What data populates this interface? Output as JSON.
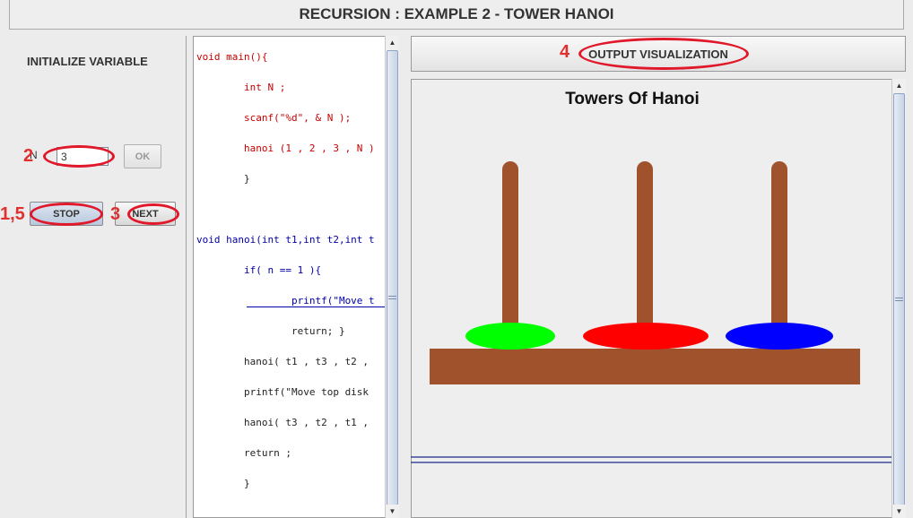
{
  "title": "RECURSION : EXAMPLE 2 - TOWER HANOI",
  "left": {
    "init_label": "INITIALIZE VARIABLE",
    "n_label": "N",
    "n_value": "3",
    "ok_label": "OK",
    "stop_label": "STOP",
    "next_label": "NEXT"
  },
  "code": [
    {
      "text": "void main(){",
      "color": "red"
    },
    {
      "text": "        int N ;",
      "color": "red"
    },
    {
      "text": "        scanf(\"%d\", & N );",
      "color": "red"
    },
    {
      "text": "        hanoi (1 , 2 , 3 , N )",
      "color": "red"
    },
    {
      "text": "        }",
      "color": "black"
    },
    {
      "text": "",
      "color": "black"
    },
    {
      "text": "void hanoi(int t1,int t2,int t",
      "color": "blue"
    },
    {
      "text": "        if( n == 1 ){",
      "color": "blue"
    },
    {
      "text": "                printf(\"Move t",
      "color": "blue"
    },
    {
      "text": "                return; }",
      "color": "black"
    },
    {
      "text": "        hanoi( t1 , t3 , t2 ,",
      "color": "black"
    },
    {
      "text": "        printf(\"Move top disk",
      "color": "black"
    },
    {
      "text": "        hanoi( t3 , t2 , t1 ,",
      "color": "black"
    },
    {
      "text": "        return ;",
      "color": "black"
    },
    {
      "text": "        }",
      "color": "black"
    }
  ],
  "output": {
    "header": "OUTPUT VISUALIZATION",
    "canvas_title": "Towers Of Hanoi"
  },
  "annotations": {
    "n_step": "2",
    "stop_step": "1,5",
    "next_step": "3",
    "output_step": "4"
  },
  "colors": {
    "peg": "#a0522d",
    "disk_peg1": "#00ff00",
    "disk_peg2": "#ff0000",
    "disk_peg3": "#0000ff",
    "annotation": "#e0182a"
  }
}
